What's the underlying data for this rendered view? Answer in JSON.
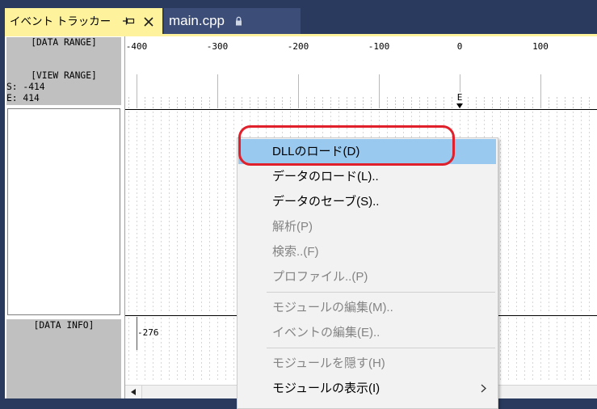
{
  "tabs": [
    {
      "label": "イベント トラッカー",
      "active": true,
      "icons": [
        "pin-icon",
        "close-icon"
      ]
    },
    {
      "label": "main.cpp",
      "active": false,
      "icons": [
        "lock-icon"
      ]
    }
  ],
  "left_panel": {
    "data_range_header": "[DATA RANGE]",
    "view_range_header": "[VIEW RANGE]",
    "view_start": "S: -414",
    "view_end": "E: 414",
    "data_info_header": "[DATA INFO]"
  },
  "timeline": {
    "ticks": [
      -400,
      -300,
      -200,
      -100,
      0,
      100
    ],
    "tick_labels": [
      "-400",
      "-300",
      "-200",
      "-100",
      "0",
      "100"
    ],
    "marker": {
      "label": "E",
      "position": 0
    },
    "data_info_value": "-276"
  },
  "context_menu": {
    "items": [
      {
        "label": "DLLのロード(D)",
        "enabled": true,
        "highlighted": true
      },
      {
        "label": "データのロード(L)..",
        "enabled": true
      },
      {
        "label": "データのセーブ(S)..",
        "enabled": true
      },
      {
        "label": "解析(P)",
        "enabled": false
      },
      {
        "label": "検索..(F)",
        "enabled": false
      },
      {
        "label": "プロファイル..(P)",
        "enabled": false
      },
      {
        "separator": true
      },
      {
        "label": "モジュールの編集(M)..",
        "enabled": false
      },
      {
        "label": "イベントの編集(E)..",
        "enabled": false
      },
      {
        "separator": true
      },
      {
        "label": "モジュールを隠す(H)",
        "enabled": false
      },
      {
        "label": "モジュールの表示(I)",
        "enabled": true,
        "submenu": true
      }
    ]
  },
  "colors": {
    "frame": "#293a5e",
    "tab_active": "#fff29d",
    "tab_inactive": "#3c4e78",
    "panel_gray": "#c0c0c0",
    "menu_highlight": "#99c9ef",
    "annotation": "#e0202a"
  }
}
